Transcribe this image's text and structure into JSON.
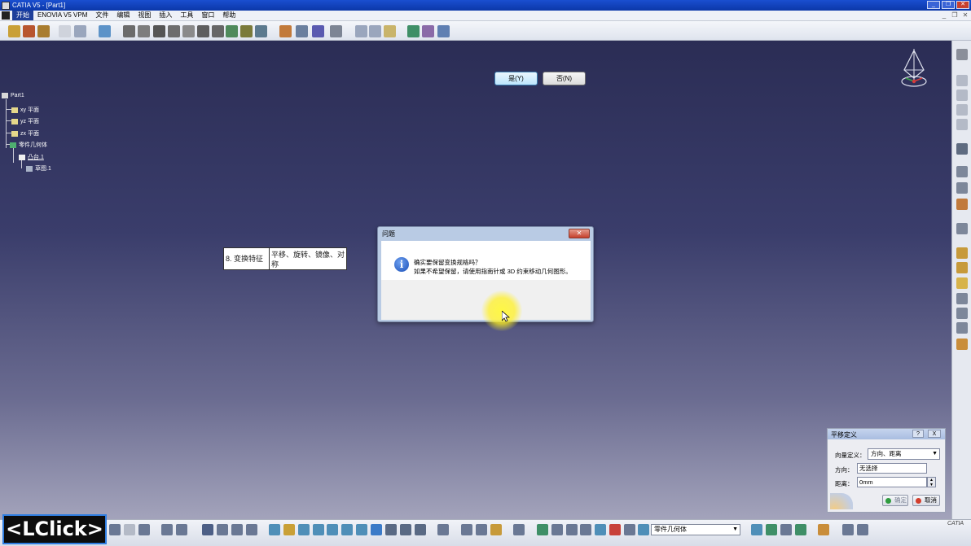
{
  "window": {
    "title": "CATIA V5 - [Part1]",
    "controls": [
      "_",
      "❐",
      "✕"
    ]
  },
  "menu": {
    "items": [
      "开始",
      "ENOVIA V5 VPM",
      "文件",
      "编辑",
      "视图",
      "插入",
      "工具",
      "窗口",
      "帮助"
    ],
    "doc_controls": [
      "_",
      "❐",
      "✕"
    ]
  },
  "tree": {
    "root": "Part1",
    "planes": [
      "xy 平面",
      "yz 平面",
      "zx 平面"
    ],
    "body": "零件几何体",
    "pad": "凸台.1",
    "sketch": "草图.1"
  },
  "feature_table": {
    "left": "8. 变换特征",
    "right": "平移、旋转、镜像、对称"
  },
  "dialog": {
    "title": "问题",
    "close_label": "✕",
    "line1": "确实要保留变换规格吗？",
    "line2": "如果不希望保留，请使用指南针或 3D 约束移动几何图形。",
    "yes_label": "是(Y)",
    "no_label": "否(N)",
    "info_icon": "i"
  },
  "translate_panel": {
    "title": "平移定义",
    "help_label": "?",
    "close_label": "X",
    "vector_label": "向量定义：",
    "vector_value": "方向、距离",
    "direction_label": "方向：",
    "direction_value": "无选择",
    "distance_label": "距离：",
    "distance_value": "0mm",
    "ok_label": "确定",
    "cancel_label": "取消"
  },
  "bottom_toolbar": {
    "body_select": "零件几何体"
  },
  "overlay": {
    "action": "<LClick>"
  },
  "colors": {
    "title_bar": "#0b37a8",
    "viewport_top": "#2b2d55",
    "viewport_bottom": "#a3a3bb",
    "highlight": "#fff03c",
    "overlay_border": "#2f7de0"
  }
}
